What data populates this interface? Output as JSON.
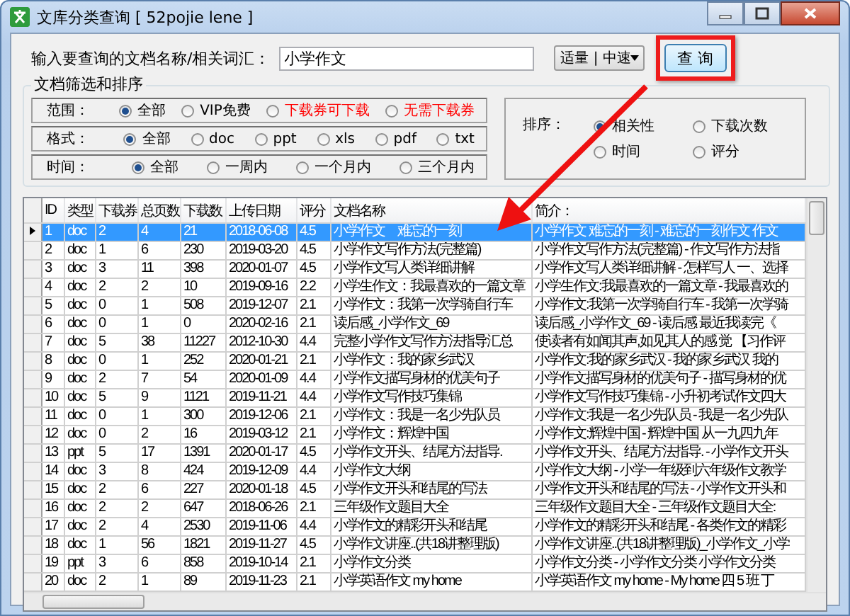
{
  "window": {
    "title": "文库分类查询 [ 52pojie lene ]"
  },
  "search": {
    "label": "输入要查询的文档名称/相关词汇：",
    "value": "小学作文",
    "speed": "适量 | 中速",
    "button": "查 询",
    "highlighted": true
  },
  "filters": {
    "title": "文档筛选和排序",
    "rows": [
      {
        "label": "范围：",
        "options": [
          {
            "label": "全部",
            "selected": true,
            "color": "#000000"
          },
          {
            "label": "VIP免费",
            "selected": false,
            "color": "#000000"
          },
          {
            "label": "下载券可下载",
            "selected": false,
            "color": "#ff0000"
          },
          {
            "label": "无需下载券",
            "selected": false,
            "color": "#ff0000"
          }
        ]
      },
      {
        "label": "格式：",
        "options": [
          {
            "label": "全部",
            "selected": true
          },
          {
            "label": "doc",
            "selected": false
          },
          {
            "label": "ppt",
            "selected": false
          },
          {
            "label": "xls",
            "selected": false
          },
          {
            "label": "pdf",
            "selected": false
          },
          {
            "label": "txt",
            "selected": false
          }
        ]
      },
      {
        "label": "时间：",
        "options": [
          {
            "label": "全部",
            "selected": true
          },
          {
            "label": "一周内",
            "selected": false
          },
          {
            "label": "一个月内",
            "selected": false
          },
          {
            "label": "三个月内",
            "selected": false
          }
        ]
      }
    ],
    "sort": {
      "label": "排序：",
      "options": [
        {
          "label": "相关性",
          "selected": true
        },
        {
          "label": "下载次数",
          "selected": false
        },
        {
          "label": "时间",
          "selected": false
        },
        {
          "label": "评分",
          "selected": false
        }
      ]
    }
  },
  "table": {
    "columns": [
      "ID",
      "类型",
      "下载券",
      "总页数",
      "下载数",
      "上传日期",
      "评分",
      "文档名称",
      "简介："
    ],
    "rows": [
      {
        "selected": true,
        "cells": [
          "1",
          "doc",
          "2",
          "4",
          "21",
          "2018-06-08",
          "4.5",
          "小学作文　难忘的一刻",
          "小学作文 难忘的一刻 - 难忘的一刻作文 作文"
        ]
      },
      {
        "selected": false,
        "cells": [
          "2",
          "doc",
          "1",
          "6",
          "230",
          "2019-03-20",
          "4.5",
          "小学作文写作方法(完整篇)",
          "小学作文写作方法(完整篇) - 作文写作方法指"
        ]
      },
      {
        "selected": false,
        "cells": [
          "3",
          "doc",
          "3",
          "11",
          "398",
          "2020-01-07",
          "4.5",
          "小学作文写人类详细讲解",
          "小学作文写人类详细讲解 - 怎样写人 一、选择"
        ]
      },
      {
        "selected": false,
        "cells": [
          "4",
          "doc",
          "2",
          "2",
          "10",
          "2019-09-16",
          "2.2",
          "小学生作文：我最喜欢的一篇文章",
          "小学生作文:我最喜欢的一篇文章 - 我最喜欢的"
        ]
      },
      {
        "selected": false,
        "cells": [
          "5",
          "doc",
          "0",
          "1",
          "508",
          "2019-12-07",
          "2.1",
          "小学作文：我第一次学骑自行车",
          "小学作文:我第一次学骑自行车 - 我第一次学骑"
        ]
      },
      {
        "selected": false,
        "cells": [
          "6",
          "doc",
          "0",
          "1",
          "0",
          "2020-02-16",
          "2.1",
          "读后感_小学作文_69",
          "读后感_小学作文_69 - 读后感 最近我读完《"
        ]
      },
      {
        "selected": false,
        "cells": [
          "7",
          "doc",
          "5",
          "38",
          "11227",
          "2012-10-30",
          "4.4",
          "完整小学作文写作方法指导汇总",
          "使读者有如闻其声,如见其人的感 觉 【习作评"
        ]
      },
      {
        "selected": false,
        "cells": [
          "8",
          "doc",
          "0",
          "1",
          "252",
          "2020-01-21",
          "2.1",
          "小学作文：我的家乡武汉",
          "小学作文:我的家乡武汉 - 我的家乡武汉 我的"
        ]
      },
      {
        "selected": false,
        "cells": [
          "9",
          "doc",
          "2",
          "7",
          "54",
          "2020-01-09",
          "4.4",
          "小学作文描写身材的优美句子",
          "小学作文描写身材的优美句子 - 描写身材的优"
        ]
      },
      {
        "selected": false,
        "cells": [
          "10",
          "doc",
          "5",
          "9",
          "1121",
          "2019-11-21",
          "4.4",
          "小学作文写作技巧集锦",
          "小学作文写作技巧集锦 - 小升初考试作文四大"
        ]
      },
      {
        "selected": false,
        "cells": [
          "11",
          "doc",
          "0",
          "1",
          "300",
          "2019-12-06",
          "2.1",
          "小学作文：我是一名少先队员",
          "小学作文:我是一名少先队员 - 我是一名少先队"
        ]
      },
      {
        "selected": false,
        "cells": [
          "12",
          "doc",
          "0",
          "2",
          "16",
          "2019-03-12",
          "2.1",
          "小学作文：辉煌中国",
          "小学作文:辉煌中国 - 辉煌中国 从一九四九年"
        ]
      },
      {
        "selected": false,
        "cells": [
          "13",
          "ppt",
          "5",
          "17",
          "1391",
          "2020-01-17",
          "4.5",
          "小学作文开头、结尾方法指导.",
          "小学作文开头、结尾方法指导. - 小学作文开头"
        ]
      },
      {
        "selected": false,
        "cells": [
          "14",
          "doc",
          "3",
          "8",
          "424",
          "2019-12-09",
          "4.4",
          "小学作文大纲",
          "小学作文大纲 - 小学一年级到六年级作文教学"
        ]
      },
      {
        "selected": false,
        "cells": [
          "15",
          "doc",
          "2",
          "6",
          "227",
          "2020-01-18",
          "4.5",
          "小学作文开头和结尾的写法",
          "小学作文开头和结尾的写法 - 小学作文开头和"
        ]
      },
      {
        "selected": false,
        "cells": [
          "16",
          "doc",
          "2",
          "2",
          "647",
          "2018-06-26",
          "2.1",
          "三年级作文题目大全",
          "三年级作文题目大全 - 三年级作文题目大全:"
        ]
      },
      {
        "selected": false,
        "cells": [
          "17",
          "doc",
          "2",
          "4",
          "2530",
          "2019-11-06",
          "4.4",
          "小学作文的精彩开头和结尾",
          "小学作文的精彩开头和结尾 - 各类作文的精彩"
        ]
      },
      {
        "selected": false,
        "cells": [
          "18",
          "doc",
          "1",
          "56",
          "1821",
          "2019-11-27",
          "4.5",
          "小学作文讲座..(共18讲整理版)",
          "小学作文讲座..(共18讲整理版)_小学作文_小学"
        ]
      },
      {
        "selected": false,
        "cells": [
          "19",
          "ppt",
          "3",
          "6",
          "858",
          "2019-10-14",
          "2.1",
          "小学作文分类",
          "小学作文分类 - 小学作文分类 小学作文分类"
        ]
      },
      {
        "selected": false,
        "cells": [
          "20",
          "doc",
          "2",
          "1",
          "89",
          "2019-11-23",
          "2.1",
          "小学英语作文 my home",
          "小学英语作文 my home - My home 四 5 班 丁"
        ]
      }
    ]
  },
  "annotation": {
    "arrow": true
  }
}
